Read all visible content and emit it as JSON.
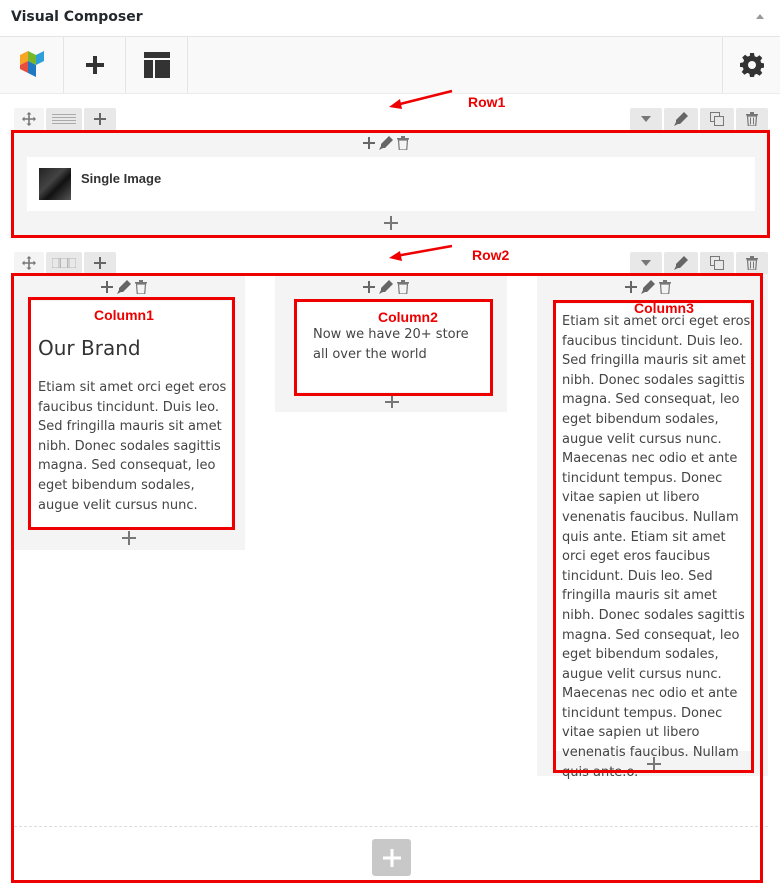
{
  "panel": {
    "title": "Visual Composer"
  },
  "toolbar": {
    "logo_icon": "visual-composer-logo",
    "add_icon": "plus-icon",
    "templates_icon": "layout-icon",
    "settings_icon": "gear-icon"
  },
  "annotations": {
    "row1": "Row1",
    "row2": "Row2",
    "column1": "Column1",
    "column2": "Column2",
    "column3": "Column3",
    "color": "#e00000"
  },
  "row1": {
    "element_title": "Single Image"
  },
  "row2": {
    "col1": {
      "heading": "Our Brand",
      "text": "Etiam sit amet orci eget eros faucibus tincidunt. Duis leo. Sed fringilla mauris sit amet nibh. Donec sodales sagittis magna. Sed consequat, leo eget bibendum sodales, augue velit cursus nunc."
    },
    "col2": {
      "text": "Now we have 20+ store all over the world"
    },
    "col3": {
      "text": "Etiam sit amet orci eget eros faucibus tincidunt. Duis leo. Sed fringilla mauris sit amet nibh. Donec sodales sagittis magna. Sed consequat, leo eget bibendum sodales, augue velit cursus nunc. Maecenas nec odio et ante tincidunt tempus. Donec vitae sapien ut libero venenatis faucibus. Nullam quis ante. Etiam sit amet orci eget eros faucibus tincidunt. Duis leo. Sed fringilla mauris sit amet nibh. Donec sodales sagittis magna. Sed consequat, leo eget bibendum sodales, augue velit cursus nunc. Maecenas nec odio et ante tincidunt tempus. Donec vitae sapien ut libero venenatis faucibus. Nullam quis ante.o."
    }
  }
}
